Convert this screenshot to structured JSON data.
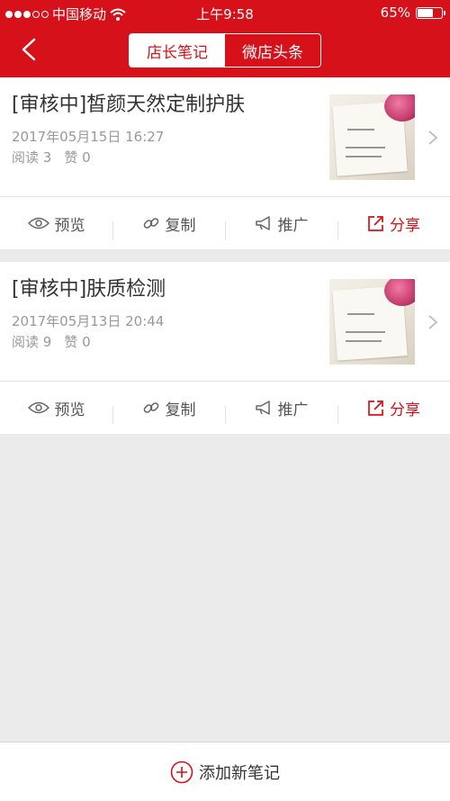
{
  "status_bar": {
    "carrier": "中国移动",
    "time": "上午9:58",
    "battery": "65%",
    "battery_level": 0.65
  },
  "header": {
    "tabs": [
      {
        "label": "店长笔记",
        "active": true
      },
      {
        "label": "微店头条",
        "active": false
      }
    ]
  },
  "notes": [
    {
      "title": "[审核中]皙颜天然定制护肤",
      "date": "2017年05月15日 16:27",
      "reads_label": "阅读 3",
      "likes_label": "赞 0"
    },
    {
      "title": "[审核中]肤质检测",
      "date": "2017年05月13日 20:44",
      "reads_label": "阅读 9",
      "likes_label": "赞 0"
    }
  ],
  "actions": {
    "preview": "预览",
    "copy": "复制",
    "promote": "推广",
    "share": "分享"
  },
  "bottom": {
    "add_label": "添加新笔记"
  },
  "colors": {
    "brand": "#d7111a",
    "background": "#ebebeb"
  }
}
